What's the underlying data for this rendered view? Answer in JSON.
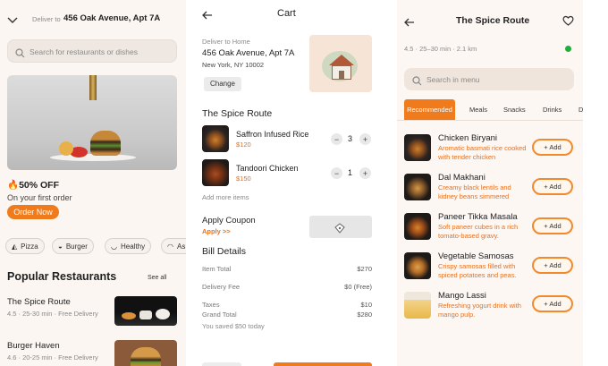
{
  "home": {
    "deliver_label": "Deliver to",
    "address": "456 Oak Avenue, Apt 7A",
    "search_placeholder": "Search for restaurants or dishes",
    "promo_title": "50% OFF",
    "promo_subtitle": "On your first order",
    "promo_button": "Order Now",
    "categories": [
      "Pizza",
      "Burger",
      "Healthy",
      "As"
    ],
    "popular_title": "Popular Restaurants",
    "see_all": "See all",
    "restaurants": [
      {
        "name": "The Spice Route",
        "meta": "4.5 · 25-30 min · Free Delivery"
      },
      {
        "name": "Burger Haven",
        "meta": "4.6 · 20-25 min · Free Delivery"
      }
    ]
  },
  "cart": {
    "title": "Cart",
    "deliver_to_label": "Deliver to Home",
    "address_line1": "456 Oak Avenue, Apt 7A",
    "address_line2": "New York, NY 10002",
    "change_button": "Change",
    "restaurant_name": "The Spice Route",
    "items": [
      {
        "name": "Saffron Infused Rice",
        "price": "$120",
        "qty": "3"
      },
      {
        "name": "Tandoori Chicken",
        "price": "$150",
        "qty": "1"
      }
    ],
    "add_more": "Add more items",
    "coupon_title": "Apply Coupon",
    "coupon_link": "Apply >>",
    "bill_title": "Bill Details",
    "bill": [
      {
        "label": "Item Total",
        "value": "$270"
      },
      {
        "label": "Delivery Fee",
        "value": "$0 (Free)"
      },
      {
        "label": "Taxes",
        "value": "$10"
      },
      {
        "label": "Grand Total",
        "value": "$280"
      }
    ],
    "savings": "You saved $50 today"
  },
  "menu": {
    "title": "The Spice Route",
    "meta": "4.5 · 25–30 min · 2.1 km",
    "search_placeholder": "Search in menu",
    "tabs": [
      "Recommended",
      "Meals",
      "Snacks",
      "Drinks",
      "D"
    ],
    "add_label": "+ Add",
    "items": [
      {
        "name": "Chicken Biryani",
        "desc": "Aromatic basmati rice cooked with tender chicken"
      },
      {
        "name": "Dal Makhani",
        "desc": "Creamy black lentils and kidney beans simmered"
      },
      {
        "name": "Paneer Tikka Masala",
        "desc": "Soft paneer cubes in a rich tomato-based gravy."
      },
      {
        "name": "Vegetable Samosas",
        "desc": "Crispy samosas filled with spiced potatoes and peas."
      },
      {
        "name": "Mango Lassi",
        "desc": "Refreshing yogurt drink with mango pulp."
      }
    ]
  },
  "colors": {
    "accent": "#f28a2c",
    "accent_text": "#e8701a",
    "online": "#1fae3a"
  }
}
